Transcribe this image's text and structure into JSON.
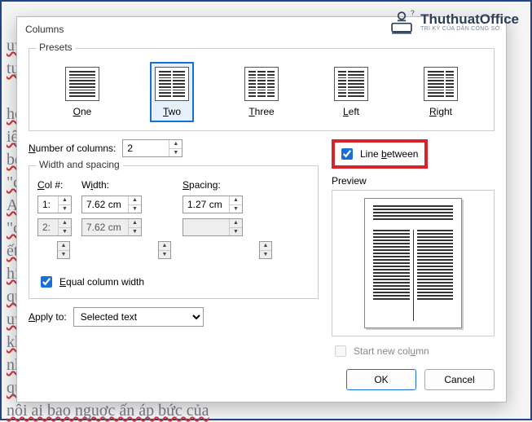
{
  "brand": {
    "title": "ThuthuatOffice",
    "sub": "TRI KỶ CỦA DÂN CÔNG SỞ"
  },
  "bg": "uyề                                                                         oặc\ntự                                                                            ạu sắc\n\nhọc\n                                                                             iệu ki\nbè                                                                          gàng \n\"cl                                                                          vi th\nA(                                                                         hư l\n\"c                                                                          hị tr\nết                                                                       nghĩ vô\nhi                                                                        \nqu                                                                            lý luậ\nuy                                                                          nại v\nkhông phủ nhận thực trạng\nnh ngay trong khi anh ta phải    trước những kẻ hơn mình về c\nquyền lực hoặc sức mạnh. Anl\nnôi ai bao nguợc ấn áp bức của",
  "dialog": {
    "title": "Columns",
    "presets": {
      "legend": "Presets",
      "items": [
        {
          "key": "one",
          "label": "One",
          "hot": "O"
        },
        {
          "key": "two",
          "label": "Two",
          "hot": "T",
          "selected": true
        },
        {
          "key": "three",
          "label": "Three",
          "hot": "T"
        },
        {
          "key": "left",
          "label": "Left",
          "hot": "L"
        },
        {
          "key": "right",
          "label": "Right",
          "hot": "R"
        }
      ]
    },
    "number_label": "Number of columns:",
    "number_value": "2",
    "line_between": {
      "label": "Line between",
      "checked": true
    },
    "width_spacing": {
      "legend": "Width and spacing",
      "col_head": "Col #:",
      "width_head": "Width:",
      "spacing_head": "Spacing:",
      "rows": [
        {
          "col": "1:",
          "width": "7.62 cm",
          "spacing": "1.27 cm",
          "enabled": true
        },
        {
          "col": "2:",
          "width": "7.62 cm",
          "spacing": "",
          "enabled": false
        }
      ],
      "equal": {
        "label": "Equal column width",
        "checked": true
      }
    },
    "preview_legend": "Preview",
    "apply": {
      "label": "Apply to:",
      "value": "Selected text"
    },
    "start_new": {
      "label": "Start new column",
      "checked": false
    },
    "ok": "OK",
    "cancel": "Cancel"
  }
}
